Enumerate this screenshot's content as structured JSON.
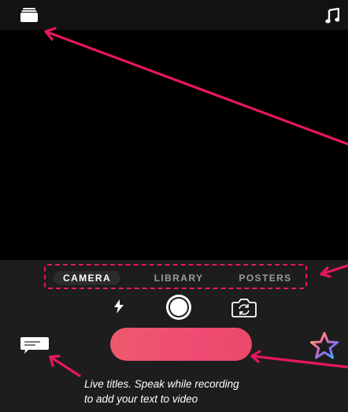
{
  "colors": {
    "annotation": "#e8175d",
    "record_start": "#ee5a6b",
    "record_end": "#e9496a",
    "panel": "#1d1d1e"
  },
  "topbar": {
    "left_icon": "stack-icon",
    "right_icon": "music-note-icon"
  },
  "mode_tabs": {
    "items": [
      {
        "label": "CAMERA",
        "active": true
      },
      {
        "label": "LIBRARY",
        "active": false
      },
      {
        "label": "POSTERS",
        "active": false
      }
    ]
  },
  "controls": {
    "flash_icon": "flash-icon",
    "shutter_icon": "shutter-icon",
    "flip_icon": "flip-camera-icon",
    "live_titles_icon": "live-titles-icon",
    "effects_icon": "star-effects-icon"
  },
  "annotation": {
    "caption_line1": "Live titles. Speak while recording",
    "caption_line2": "to add your text to video"
  }
}
